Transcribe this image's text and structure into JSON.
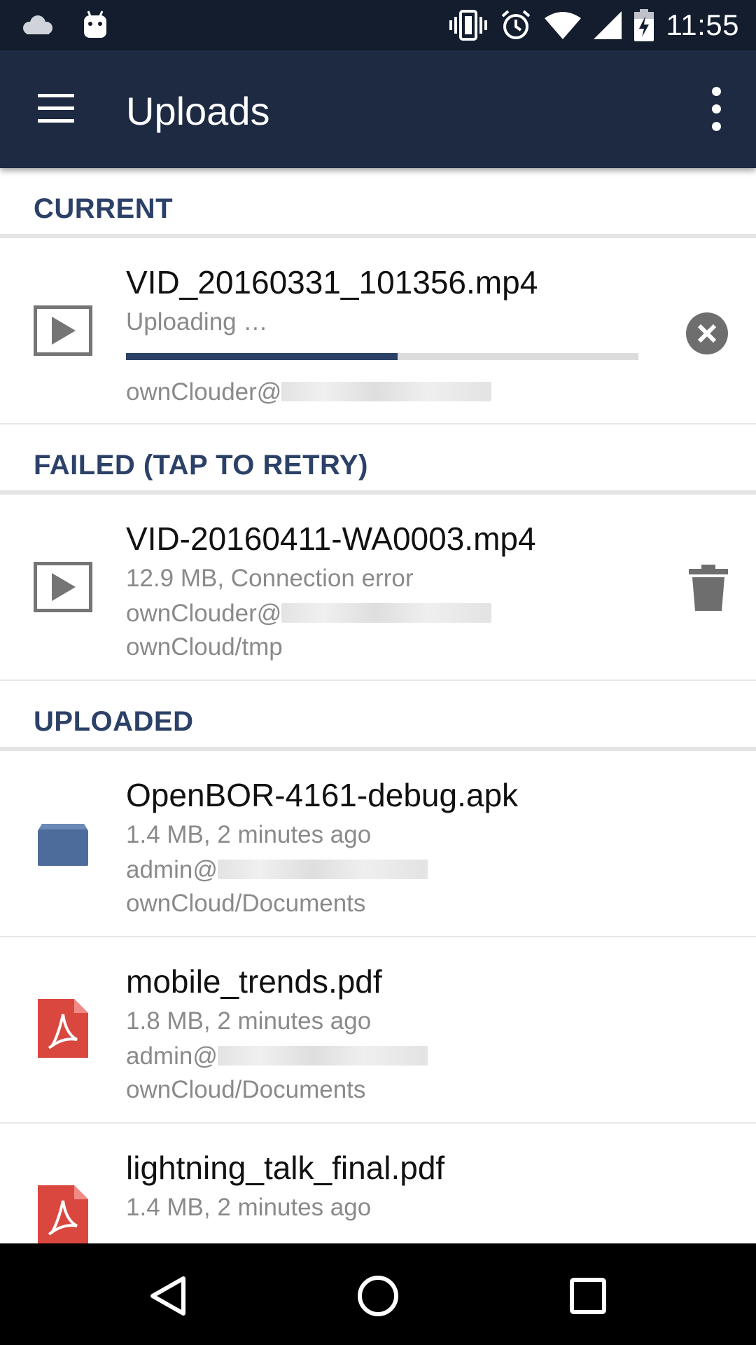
{
  "status_bar": {
    "time": "11:55",
    "icons": [
      "cloud-icon",
      "android-icon",
      "vibrate-icon",
      "alarm-icon",
      "wifi-icon",
      "signal-icon",
      "battery-charging-icon"
    ]
  },
  "app_bar": {
    "title": "Uploads",
    "menu_icon": "hamburger-menu-icon",
    "overflow_icon": "more-vert-icon",
    "background": "#1d2a42"
  },
  "accent_color": "#2c4168",
  "sections": {
    "current": {
      "header": "CURRENT",
      "items": [
        {
          "filename": "VID_20160331_101356.mp4",
          "status": "Uploading …",
          "progress": 0.53,
          "account": "ownClouder@",
          "icon": "video-file-icon",
          "action_icon": "cancel-circle-icon"
        }
      ]
    },
    "failed": {
      "header": "FAILED (TAP TO RETRY)",
      "items": [
        {
          "filename": "VID-20160411-WA0003.mp4",
          "details": "12.9 MB, Connection error",
          "account": "ownClouder@",
          "path": "ownCloud/tmp",
          "icon": "video-file-icon",
          "action_icon": "trash-icon"
        }
      ]
    },
    "uploaded": {
      "header": "UPLOADED",
      "items": [
        {
          "filename": "OpenBOR-4161-debug.apk",
          "details": "1.4 MB,  2 minutes ago",
          "account": "admin@",
          "path": "ownCloud/Documents",
          "icon": "package-file-icon"
        },
        {
          "filename": "mobile_trends.pdf",
          "details": "1.8 MB,  2 minutes ago",
          "account": "admin@",
          "path": "ownCloud/Documents",
          "icon": "pdf-file-icon"
        },
        {
          "filename": "lightning_talk_final.pdf",
          "details": "1.4 MB,  2 minutes ago",
          "icon": "pdf-file-icon"
        }
      ]
    }
  },
  "nav_bar": {
    "buttons": [
      "back-icon",
      "home-icon",
      "recents-icon"
    ]
  }
}
